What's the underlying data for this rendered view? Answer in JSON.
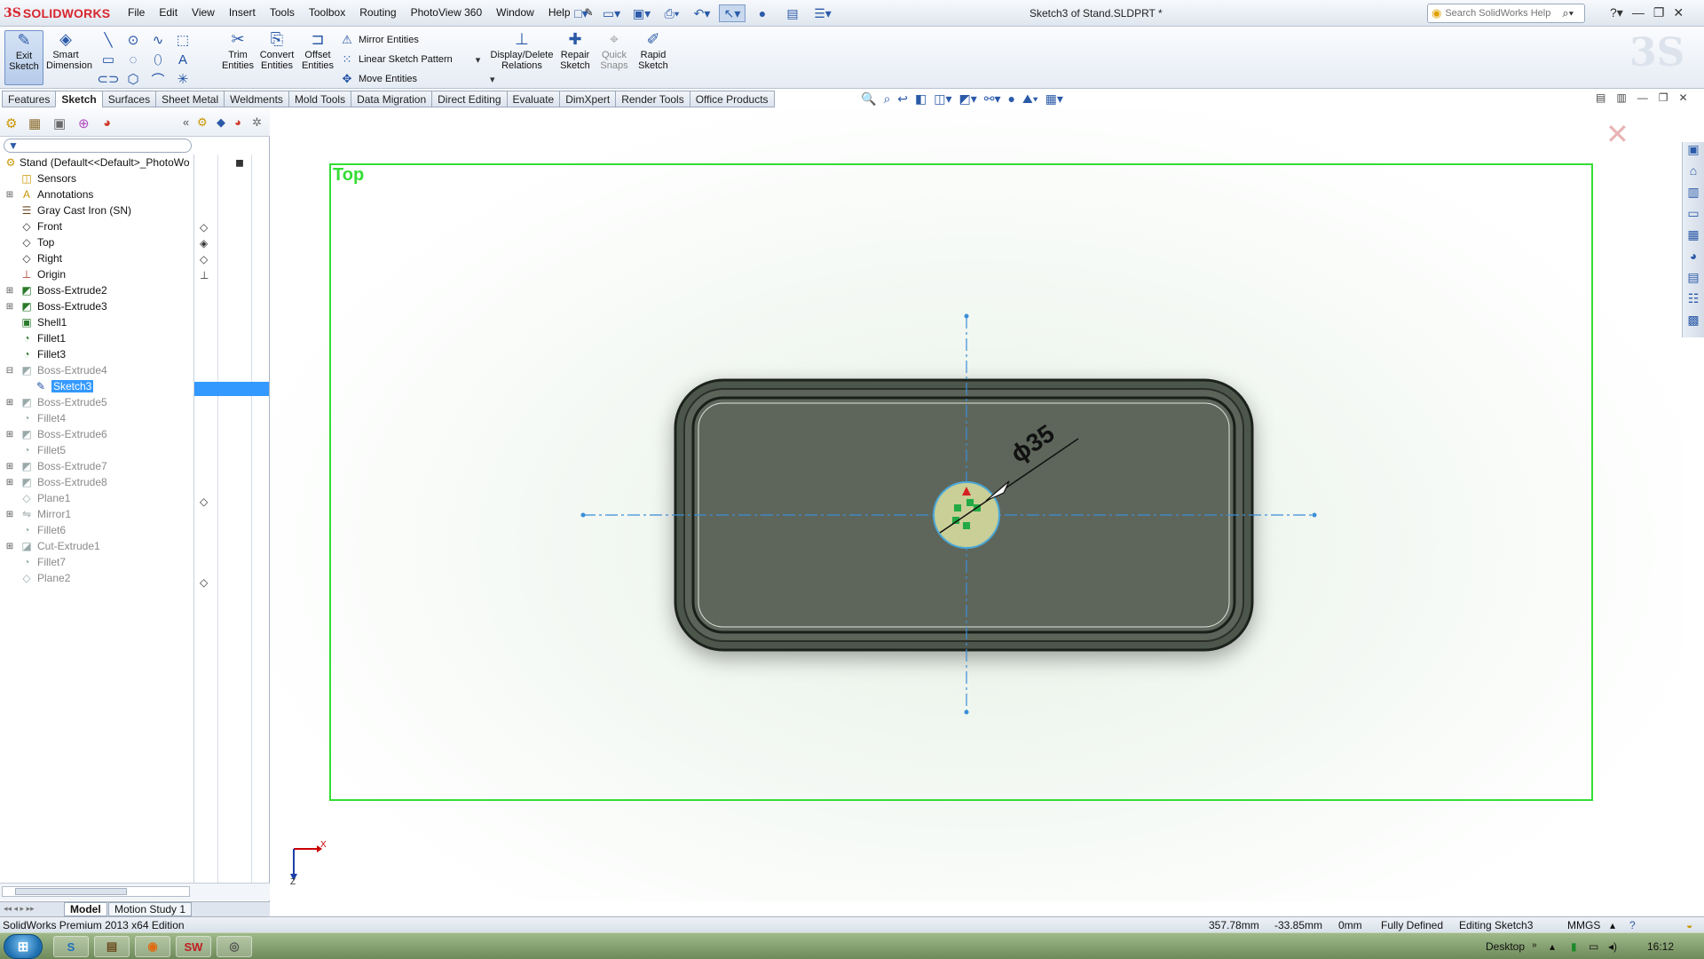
{
  "app": {
    "logo_mark": "3S",
    "logo_text": "SOLIDWORKS",
    "document_title": "Sketch3 of Stand.SLDPRT *"
  },
  "menu": [
    "File",
    "Edit",
    "View",
    "Insert",
    "Tools",
    "Toolbox",
    "Routing",
    "PhotoView 360",
    "Window",
    "Help"
  ],
  "search": {
    "placeholder": "Search SolidWorks Help"
  },
  "command_manager": {
    "exit_sketch": "Exit Sketch",
    "smart_dimension": "Smart Dimension",
    "trim_entities": "Trim Entities",
    "convert_entities": "Convert Entities",
    "offset_entities": "Offset Entities",
    "mirror_entities": "Mirror Entities",
    "linear_sketch_pattern": "Linear Sketch Pattern",
    "move_entities": "Move Entities",
    "display_delete_relations": "Display/Delete Relations",
    "repair_sketch": "Repair Sketch",
    "quick_snaps": "Quick Snaps",
    "rapid_sketch": "Rapid Sketch"
  },
  "tabs": [
    {
      "label": "Features"
    },
    {
      "label": "Sketch",
      "active": true
    },
    {
      "label": "Surfaces"
    },
    {
      "label": "Sheet Metal"
    },
    {
      "label": "Weldments"
    },
    {
      "label": "Mold Tools"
    },
    {
      "label": "Data Migration"
    },
    {
      "label": "Direct Editing"
    },
    {
      "label": "Evaluate"
    },
    {
      "label": "DimXpert"
    },
    {
      "label": "Render Tools"
    },
    {
      "label": "Office Products"
    }
  ],
  "feature_tree": {
    "root": "Stand  (Default<<Default>_PhotoWo",
    "items": [
      {
        "label": "Sensors",
        "icon": "sensor-icon",
        "expander": "",
        "state": "normal"
      },
      {
        "label": "Annotations",
        "icon": "annotations-icon",
        "expander": "+",
        "state": "normal"
      },
      {
        "label": "Gray Cast Iron (SN)",
        "icon": "material-icon",
        "expander": "",
        "state": "normal"
      },
      {
        "label": "Front",
        "icon": "plane-icon",
        "expander": "",
        "state": "normal"
      },
      {
        "label": "Top",
        "icon": "plane-icon",
        "expander": "",
        "state": "normal"
      },
      {
        "label": "Right",
        "icon": "plane-icon",
        "expander": "",
        "state": "normal"
      },
      {
        "label": "Origin",
        "icon": "origin-icon",
        "expander": "",
        "state": "normal"
      },
      {
        "label": "Boss-Extrude2",
        "icon": "extrude-icon",
        "expander": "+",
        "state": "normal"
      },
      {
        "label": "Boss-Extrude3",
        "icon": "extrude-icon",
        "expander": "+",
        "state": "normal"
      },
      {
        "label": "Shell1",
        "icon": "shell-icon",
        "expander": "",
        "state": "normal"
      },
      {
        "label": "Fillet1",
        "icon": "fillet-icon",
        "expander": "",
        "state": "normal"
      },
      {
        "label": "Fillet3",
        "icon": "fillet-icon",
        "expander": "",
        "state": "normal"
      },
      {
        "label": "Boss-Extrude4",
        "icon": "extrude-icon",
        "expander": "-",
        "state": "dim"
      },
      {
        "label": "Sketch3",
        "icon": "sketch-icon",
        "expander": "",
        "state": "selected",
        "indent": true
      },
      {
        "label": "Boss-Extrude5",
        "icon": "extrude-icon",
        "expander": "+",
        "state": "dim"
      },
      {
        "label": "Fillet4",
        "icon": "fillet-icon",
        "expander": "",
        "state": "dim"
      },
      {
        "label": "Boss-Extrude6",
        "icon": "extrude-icon",
        "expander": "+",
        "state": "dim"
      },
      {
        "label": "Fillet5",
        "icon": "fillet-icon",
        "expander": "",
        "state": "dim"
      },
      {
        "label": "Boss-Extrude7",
        "icon": "extrude-icon",
        "expander": "+",
        "state": "dim"
      },
      {
        "label": "Boss-Extrude8",
        "icon": "extrude-icon",
        "expander": "+",
        "state": "dim"
      },
      {
        "label": "Plane1",
        "icon": "plane-icon",
        "expander": "",
        "state": "dim"
      },
      {
        "label": "Mirror1",
        "icon": "mirror-icon",
        "expander": "+",
        "state": "dim"
      },
      {
        "label": "Fillet6",
        "icon": "fillet-icon",
        "expander": "",
        "state": "dim"
      },
      {
        "label": "Cut-Extrude1",
        "icon": "cut-icon",
        "expander": "+",
        "state": "dim"
      },
      {
        "label": "Fillet7",
        "icon": "fillet-icon",
        "expander": "",
        "state": "dim"
      },
      {
        "label": "Plane2",
        "icon": "plane-icon",
        "expander": "",
        "state": "dim"
      }
    ]
  },
  "graphics": {
    "plane_label": "Top",
    "dimension_text": "ϕ35",
    "axis_x_label": "X",
    "axis_z_label": "Z"
  },
  "motion_tabs": [
    "Model",
    "Motion Study 1"
  ],
  "status": {
    "edition": "SolidWorks Premium 2013 x64 Edition",
    "coord_x": "357.78mm",
    "coord_y": "-33.85mm",
    "coord_z": "0mm",
    "definition": "Fully Defined",
    "editing": "Editing Sketch3",
    "units": "MMGS"
  },
  "taskbar": {
    "desktop_label": "Desktop",
    "clock": "16:12"
  },
  "colors": {
    "sketch_plane_border": "#33dd33",
    "selection": "#3399ff",
    "part_body": "#5c6459",
    "circle_fill": "#c9cf97",
    "centerline": "#3a8ed8"
  }
}
